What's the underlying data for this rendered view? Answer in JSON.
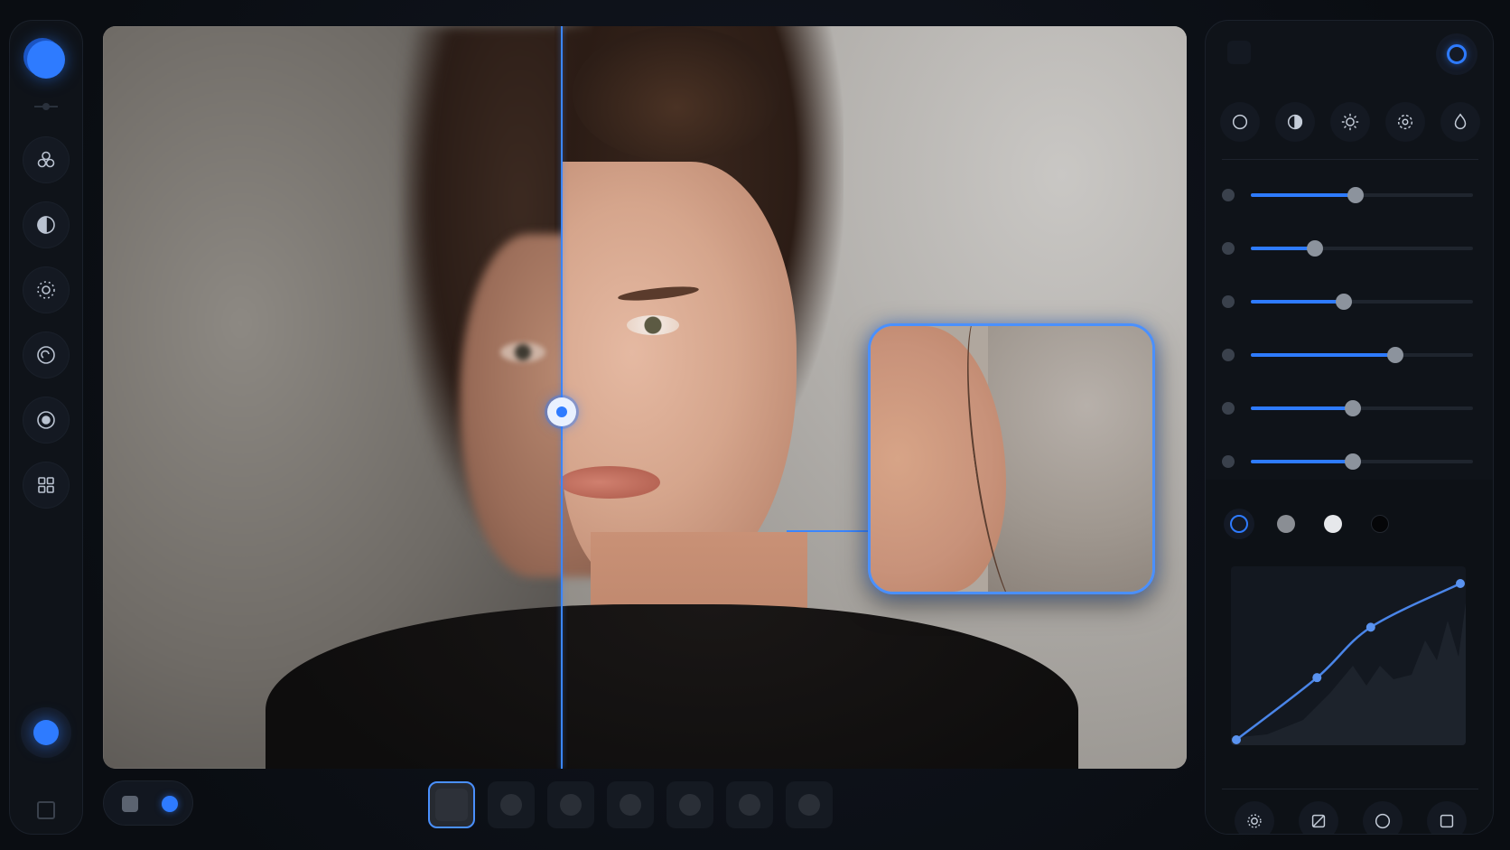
{
  "app": {
    "accent_color": "#2e7bff"
  },
  "left_toolbar": {
    "tools": [
      {
        "icon": "color-mix-icon"
      },
      {
        "icon": "contrast-icon"
      },
      {
        "icon": "exposure-icon"
      },
      {
        "icon": "spiral-icon"
      },
      {
        "icon": "target-icon"
      },
      {
        "icon": "grid-icon"
      }
    ]
  },
  "canvas": {
    "compare_split_fraction": 0.425
  },
  "filmstrip": {
    "thumbnails": 7,
    "selected_index": 0
  },
  "adjust_panel": {
    "categories": [
      {
        "icon": "circle-icon"
      },
      {
        "icon": "contrast-icon"
      },
      {
        "icon": "sun-icon"
      },
      {
        "icon": "dotted-ring-icon"
      },
      {
        "icon": "drop-icon"
      }
    ],
    "sliders": [
      0.47,
      0.29,
      0.42,
      0.65,
      0.46,
      0.46
    ],
    "channels": [
      "rgb",
      "gray",
      "white",
      "black"
    ],
    "selected_channel": "rgb",
    "tone_curve_points": [
      [
        0.0,
        0.0
      ],
      [
        0.36,
        0.37
      ],
      [
        0.6,
        0.67
      ],
      [
        1.0,
        0.93
      ]
    ],
    "bottom_tools": [
      {
        "icon": "gear-sun-icon"
      },
      {
        "icon": "curve-slash-icon"
      },
      {
        "icon": "circle-icon"
      },
      {
        "icon": "square-icon"
      }
    ]
  }
}
